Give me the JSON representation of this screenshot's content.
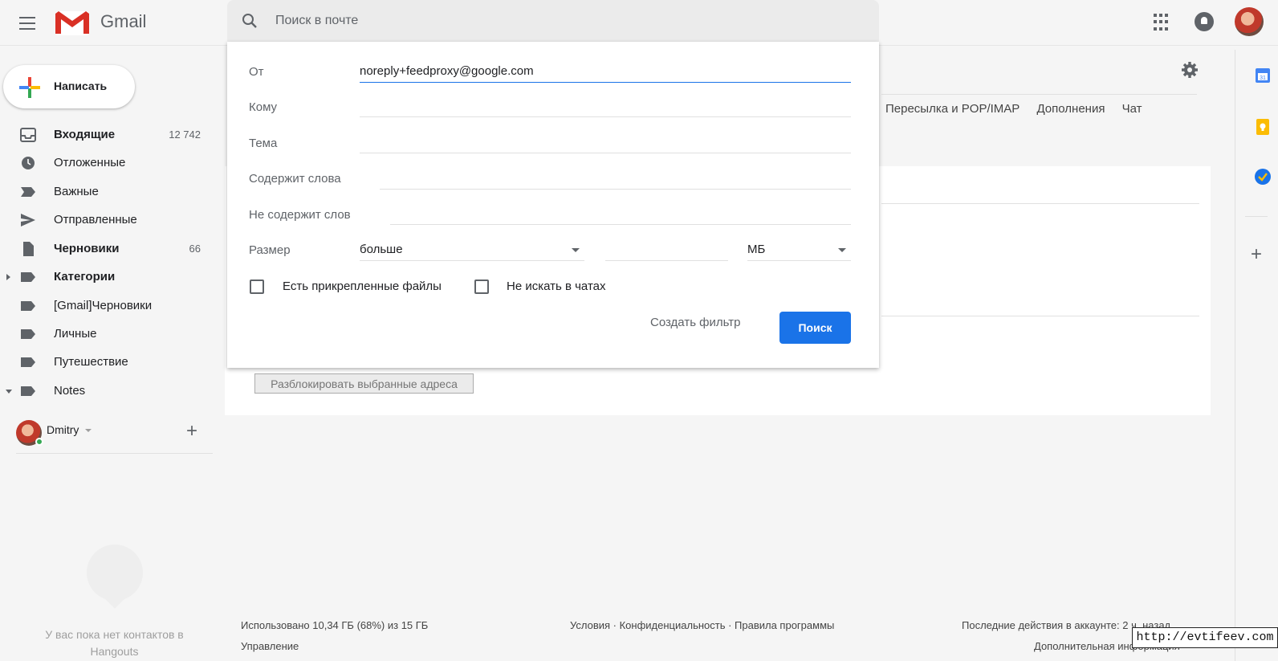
{
  "header": {
    "brand": "Gmail",
    "search_placeholder": "Поиск в почте"
  },
  "compose": {
    "label": "Написать"
  },
  "sidebar": {
    "items": [
      {
        "label": "Входящие",
        "count": "12 742",
        "icon": "inbox-icon",
        "bold": true
      },
      {
        "label": "Отложенные",
        "count": "",
        "icon": "clock-icon"
      },
      {
        "label": "Важные",
        "count": "",
        "icon": "important-icon"
      },
      {
        "label": "Отправленные",
        "count": "",
        "icon": "send-icon"
      },
      {
        "label": "Черновики",
        "count": "66",
        "icon": "draft-icon",
        "bold": true
      },
      {
        "label": "Категории",
        "count": "",
        "icon": "label-icon",
        "bold": true
      },
      {
        "label": "[Gmail]Черновики",
        "count": "",
        "icon": "label-icon"
      },
      {
        "label": "Личные",
        "count": "",
        "icon": "label-icon"
      },
      {
        "label": "Путешествие",
        "count": "",
        "icon": "label-icon"
      },
      {
        "label": "Notes",
        "count": "",
        "icon": "label-icon"
      }
    ]
  },
  "hangouts": {
    "user_name": "Dmitry",
    "empty_text": "У вас пока нет контактов в Hangouts"
  },
  "settings": {
    "tabs": [
      "Пересылка и POP/IMAP",
      "Дополнения",
      "Чат"
    ],
    "unblock_button": "Разблокировать выбранные адреса"
  },
  "advanced_search": {
    "from_label": "От",
    "from_value": "noreply+feedproxy@google.com",
    "to_label": "Кому",
    "subject_label": "Тема",
    "has_words_label": "Содержит слова",
    "no_words_label": "Не содержит слов",
    "size_label": "Размер",
    "size_operator": "больше",
    "size_unit": "МБ",
    "has_attachment_label": "Есть прикрепленные файлы",
    "no_chats_label": "Не искать в чатах",
    "create_filter": "Создать фильтр",
    "search_button": "Поиск"
  },
  "footer": {
    "storage": "Использовано 10,34 ГБ (68%) из 15 ГБ",
    "manage": "Управление",
    "links": "Условия · Конфиденциальность · Правила программы",
    "last_activity": "Последние действия в аккаунте: 2 ч. назад",
    "details": "Дополнительная информация"
  },
  "watermark": "http://evtifeev.com",
  "colors": {
    "accent": "#1a73e8",
    "background": "#f5f5f5"
  }
}
